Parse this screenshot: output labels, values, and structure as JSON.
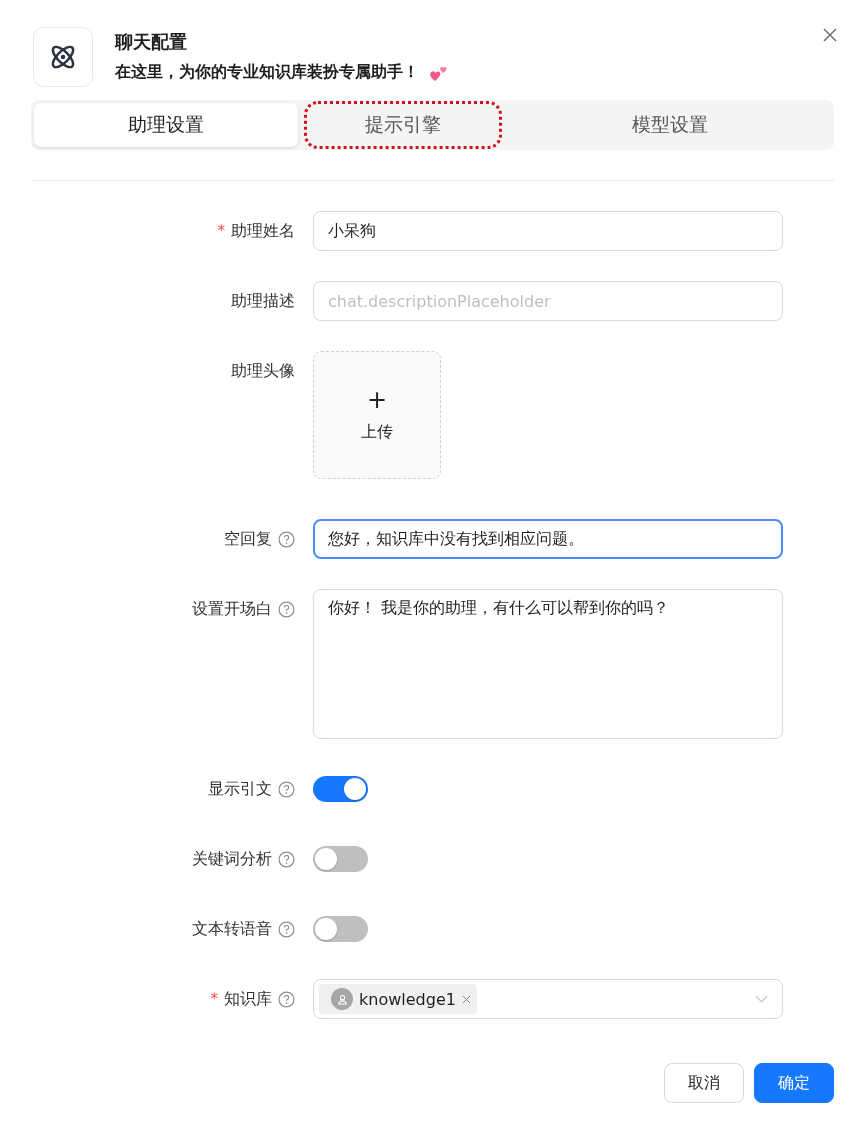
{
  "dialog": {
    "title": "聊天配置",
    "subtitle": "在这里，为你的专业知识库装扮专属助手！"
  },
  "tabs": [
    {
      "label": "助理设置",
      "selected": true,
      "highlighted": false
    },
    {
      "label": "提示引擎",
      "selected": false,
      "highlighted": true
    },
    {
      "label": "模型设置",
      "selected": false,
      "highlighted": false
    }
  ],
  "fields": [
    {
      "kind": "text",
      "label": "助理姓名",
      "required_mark": "*",
      "help": false,
      "value": "小呆狗",
      "focused": false
    },
    {
      "kind": "text",
      "label": "助理描述",
      "help": false,
      "placeholder": "chat.descriptionPlaceholder",
      "focused": false
    },
    {
      "kind": "upload",
      "label": "助理头像",
      "help": false,
      "icon": "+",
      "text": "上传"
    },
    {
      "kind": "text",
      "label": "空回复",
      "help": true,
      "value": "您好，知识库中没有找到相应问题。",
      "focused": true
    },
    {
      "kind": "textarea",
      "label": "设置开场白",
      "help": true,
      "value": "你好！ 我是你的助理，有什么可以帮到你的吗？"
    },
    {
      "kind": "switch",
      "label": "显示引文",
      "help": true,
      "on": true
    },
    {
      "kind": "switch",
      "label": "关键词分析",
      "help": true,
      "on": false
    },
    {
      "kind": "switch",
      "label": "文本转语音",
      "help": true,
      "on": false
    },
    {
      "kind": "select",
      "label": "知识库",
      "required_mark": "*",
      "help": true,
      "tags": [
        "knowledge1"
      ]
    }
  ],
  "buttons": [
    {
      "label": "取消",
      "kind": "default"
    },
    {
      "label": "确定",
      "kind": "primary"
    }
  ]
}
